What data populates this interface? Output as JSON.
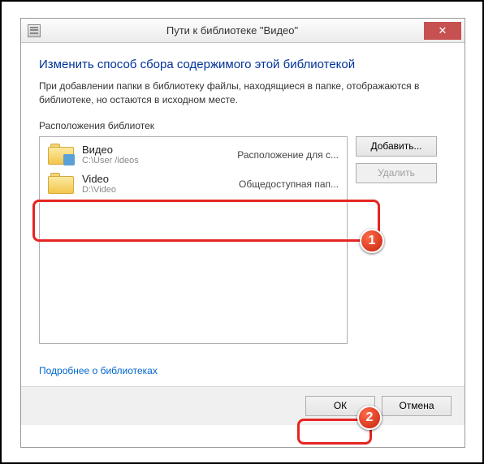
{
  "window": {
    "title": "Пути к библиотеке \"Видео\""
  },
  "content": {
    "heading": "Изменить способ сбора содержимого этой библиотекой",
    "description": "При добавлении папки в библиотеку файлы, находящиеся в папке, отображаются в библиотеке, но остаются в исходном месте.",
    "list_label": "Расположения библиотек"
  },
  "buttons": {
    "add": "Добавить...",
    "remove": "Удалить",
    "ok": "ОК",
    "cancel": "Отмена"
  },
  "link": {
    "learn_more": "Подробнее о библиотеках"
  },
  "items": [
    {
      "name": "Видео",
      "path": "C:\\User           /ideos",
      "desc": "Расположение для с...",
      "icon": "video"
    },
    {
      "name": "Video",
      "path": "D:\\Video",
      "desc": "Общедоступная пап...",
      "icon": "plain"
    }
  ],
  "annotations": {
    "badge1": "1",
    "badge2": "2"
  }
}
